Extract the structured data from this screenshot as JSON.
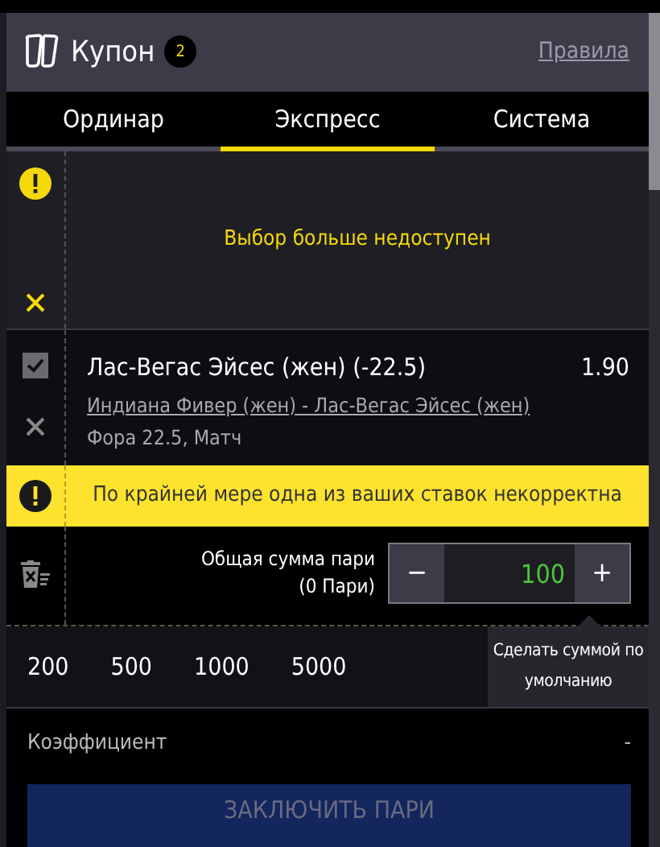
{
  "header": {
    "title": "Купон",
    "count": "2",
    "rules_link": "Правила"
  },
  "tabs": [
    {
      "label": "Ординар",
      "selected": false
    },
    {
      "label": "Экспресс",
      "selected": true
    },
    {
      "label": "Система",
      "selected": false
    }
  ],
  "unavailable": {
    "message": "Выбор больше недоступен"
  },
  "bet": {
    "checked": true,
    "selection": "Лас-Вегас Эйсес (жен) (-22.5)",
    "odds": "1.90",
    "match": "Индиана Фивер (жен) - Лас-Вегас Эйсес (жен)",
    "market": "Фора 22.5, Матч"
  },
  "warning": "По крайней мере одна из ваших ставок некорректна",
  "stake": {
    "label": "Общая сумма пари",
    "sub": "(0 Пари)",
    "minus": "−",
    "value": "100",
    "plus": "+"
  },
  "quick_amounts": [
    "200",
    "500",
    "1000",
    "5000"
  ],
  "tooltip": "Сделать суммой по умолчанию",
  "coefficient": {
    "label": "Коэффициент",
    "value": "-"
  },
  "submit": {
    "label": "ЗАКЛЮЧИТЬ ПАРИ",
    "disabled": true
  }
}
